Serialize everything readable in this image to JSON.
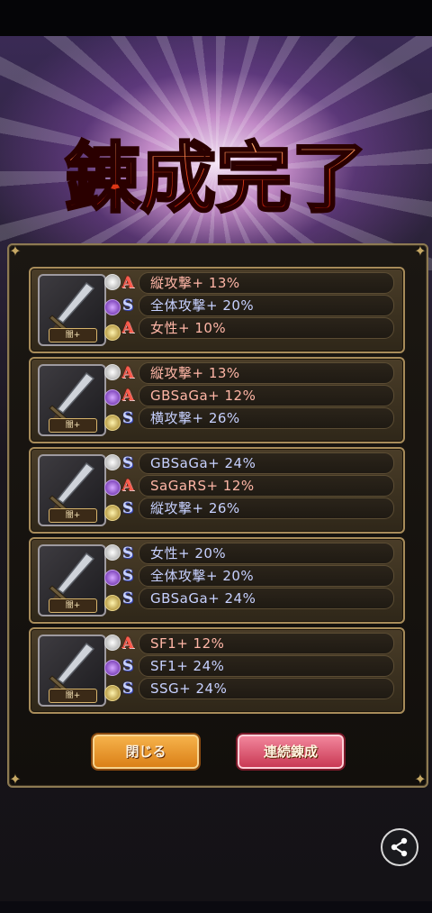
{
  "title": "錬成完了",
  "cards": [
    {
      "thumb_label": "闇+",
      "slots": [
        "white",
        "purple",
        "yellow"
      ],
      "rows": [
        {
          "type": "A",
          "text": "縦攻撃+ 13%"
        },
        {
          "type": "S",
          "text": "全体攻撃+ 20%"
        },
        {
          "type": "A",
          "text": "女性+ 10%"
        }
      ]
    },
    {
      "thumb_label": "闇+",
      "slots": [
        "white",
        "purple",
        "yellow"
      ],
      "rows": [
        {
          "type": "A",
          "text": "縦攻撃+ 13%"
        },
        {
          "type": "A",
          "text": "GBSaGa+ 12%"
        },
        {
          "type": "S",
          "text": "横攻撃+ 26%"
        }
      ]
    },
    {
      "thumb_label": "闇+",
      "slots": [
        "white",
        "purple",
        "yellow"
      ],
      "rows": [
        {
          "type": "S",
          "text": "GBSaGa+ 24%"
        },
        {
          "type": "A",
          "text": "SaGaRS+ 12%"
        },
        {
          "type": "S",
          "text": "縦攻撃+ 26%"
        }
      ]
    },
    {
      "thumb_label": "闇+",
      "slots": [
        "white",
        "purple",
        "yellow"
      ],
      "rows": [
        {
          "type": "S",
          "text": "女性+ 20%"
        },
        {
          "type": "S",
          "text": "全体攻撃+ 20%"
        },
        {
          "type": "S",
          "text": "GBSaGa+ 24%"
        }
      ]
    },
    {
      "thumb_label": "闇+",
      "slots": [
        "white",
        "purple",
        "yellow"
      ],
      "rows": [
        {
          "type": "A",
          "text": "SF1+ 12%"
        },
        {
          "type": "S",
          "text": "SF1+ 24%"
        },
        {
          "type": "S",
          "text": "SSG+ 24%"
        }
      ]
    }
  ],
  "buttons": {
    "close_label": "閉じる",
    "continue_label": "連続錬成"
  },
  "icons": {
    "share": "share-icon",
    "type_a": "rank-a-icon",
    "type_s": "rank-s-icon"
  }
}
